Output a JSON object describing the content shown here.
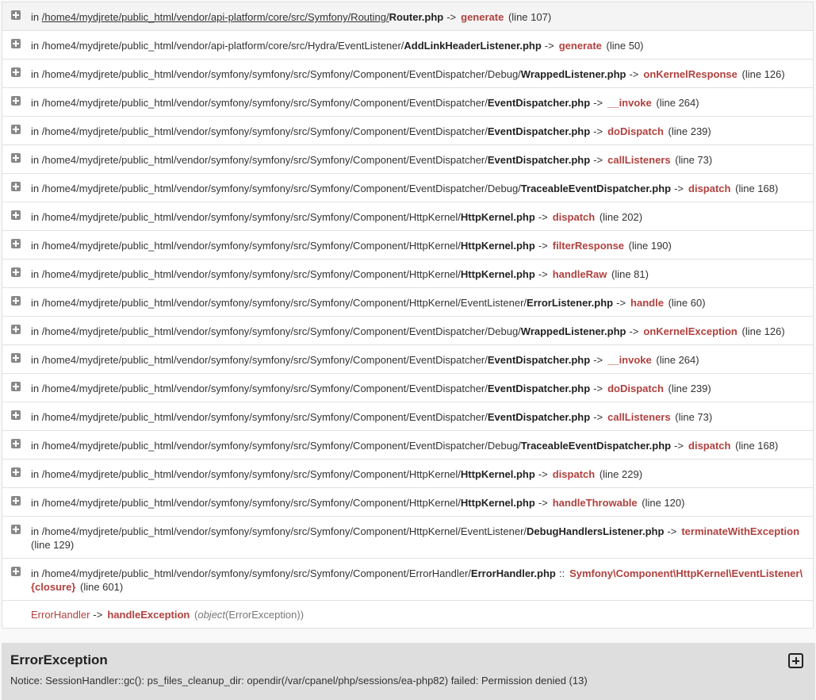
{
  "trace_rows": [
    {
      "prefix": "in",
      "path": "/home4/mydjrete/public_html/vendor/api-platform/core/src/Symfony/Routing/",
      "file": "Router.php",
      "sep": "->",
      "method": "generate",
      "line": "(line 107)"
    },
    {
      "prefix": "in",
      "path": "/home4/mydjrete/public_html/vendor/api-platform/core/src/Hydra/EventListener/",
      "file": "AddLinkHeaderListener.php",
      "sep": "->",
      "method": "generate",
      "line": "(line 50)"
    },
    {
      "prefix": "in",
      "path": "/home4/mydjrete/public_html/vendor/symfony/symfony/src/Symfony/Component/EventDispatcher/Debug/",
      "file": "WrappedListener.php",
      "sep": "->",
      "method": "onKernelResponse",
      "line": "(line 126)"
    },
    {
      "prefix": "in",
      "path": "/home4/mydjrete/public_html/vendor/symfony/symfony/src/Symfony/Component/EventDispatcher/",
      "file": "EventDispatcher.php",
      "sep": "->",
      "method": "__invoke",
      "line": "(line 264)"
    },
    {
      "prefix": "in",
      "path": "/home4/mydjrete/public_html/vendor/symfony/symfony/src/Symfony/Component/EventDispatcher/",
      "file": "EventDispatcher.php",
      "sep": "->",
      "method": "doDispatch",
      "line": "(line 239)"
    },
    {
      "prefix": "in",
      "path": "/home4/mydjrete/public_html/vendor/symfony/symfony/src/Symfony/Component/EventDispatcher/",
      "file": "EventDispatcher.php",
      "sep": "->",
      "method": "callListeners",
      "line": "(line 73)"
    },
    {
      "prefix": "in",
      "path": "/home4/mydjrete/public_html/vendor/symfony/symfony/src/Symfony/Component/EventDispatcher/Debug/",
      "file": "TraceableEventDispatcher.php",
      "sep": "->",
      "method": "dispatch",
      "line": "(line 168)"
    },
    {
      "prefix": "in",
      "path": "/home4/mydjrete/public_html/vendor/symfony/symfony/src/Symfony/Component/HttpKernel/",
      "file": "HttpKernel.php",
      "sep": "->",
      "method": "dispatch",
      "line": "(line 202)"
    },
    {
      "prefix": "in",
      "path": "/home4/mydjrete/public_html/vendor/symfony/symfony/src/Symfony/Component/HttpKernel/",
      "file": "HttpKernel.php",
      "sep": "->",
      "method": "filterResponse",
      "line": "(line 190)"
    },
    {
      "prefix": "in",
      "path": "/home4/mydjrete/public_html/vendor/symfony/symfony/src/Symfony/Component/HttpKernel/",
      "file": "HttpKernel.php",
      "sep": "->",
      "method": "handleRaw",
      "line": "(line 81)"
    },
    {
      "prefix": "in",
      "path": "/home4/mydjrete/public_html/vendor/symfony/symfony/src/Symfony/Component/HttpKernel/EventListener/",
      "file": "ErrorListener.php",
      "sep": "->",
      "method": "handle",
      "line": "(line 60)"
    },
    {
      "prefix": "in",
      "path": "/home4/mydjrete/public_html/vendor/symfony/symfony/src/Symfony/Component/EventDispatcher/Debug/",
      "file": "WrappedListener.php",
      "sep": "->",
      "method": "onKernelException",
      "line": "(line 126)"
    },
    {
      "prefix": "in",
      "path": "/home4/mydjrete/public_html/vendor/symfony/symfony/src/Symfony/Component/EventDispatcher/",
      "file": "EventDispatcher.php",
      "sep": "->",
      "method": "__invoke",
      "line": "(line 264)"
    },
    {
      "prefix": "in",
      "path": "/home4/mydjrete/public_html/vendor/symfony/symfony/src/Symfony/Component/EventDispatcher/",
      "file": "EventDispatcher.php",
      "sep": "->",
      "method": "doDispatch",
      "line": "(line 239)"
    },
    {
      "prefix": "in",
      "path": "/home4/mydjrete/public_html/vendor/symfony/symfony/src/Symfony/Component/EventDispatcher/",
      "file": "EventDispatcher.php",
      "sep": "->",
      "method": "callListeners",
      "line": "(line 73)"
    },
    {
      "prefix": "in",
      "path": "/home4/mydjrete/public_html/vendor/symfony/symfony/src/Symfony/Component/EventDispatcher/Debug/",
      "file": "TraceableEventDispatcher.php",
      "sep": "->",
      "method": "dispatch",
      "line": "(line 168)"
    },
    {
      "prefix": "in",
      "path": "/home4/mydjrete/public_html/vendor/symfony/symfony/src/Symfony/Component/HttpKernel/",
      "file": "HttpKernel.php",
      "sep": "->",
      "method": "dispatch",
      "line": "(line 229)"
    },
    {
      "prefix": "in",
      "path": "/home4/mydjrete/public_html/vendor/symfony/symfony/src/Symfony/Component/HttpKernel/",
      "file": "HttpKernel.php",
      "sep": "->",
      "method": "handleThrowable",
      "line": "(line 120)"
    },
    {
      "prefix": "in",
      "path": "/home4/mydjrete/public_html/vendor/symfony/symfony/src/Symfony/Component/HttpKernel/EventListener/",
      "file": "DebugHandlersListener.php",
      "sep": "->",
      "method": "terminateWithException",
      "line": "(line 129)"
    },
    {
      "prefix": "in",
      "path": "/home4/mydjrete/public_html/vendor/symfony/symfony/src/Symfony/Component/ErrorHandler/",
      "file": "ErrorHandler.php",
      "sep": "::",
      "method": "Symfony\\Component\\HttpKernel\\EventListener\\{closure}",
      "line": "(line 601)"
    }
  ],
  "last_row": {
    "class": "ErrorHandler",
    "sep": "->",
    "method": "handleException",
    "open": "(",
    "arg_type": "object",
    "arg_value": "(ErrorException)",
    "close": ")"
  },
  "exception": {
    "title": "ErrorException",
    "message": "Notice: SessionHandler::gc(): ps_files_cleanup_dir: opendir(/var/cpanel/php/sessions/ea-php82) failed: Permission denied (13)"
  },
  "colors": {
    "method": "#b0413e",
    "panel": "#dedede"
  }
}
